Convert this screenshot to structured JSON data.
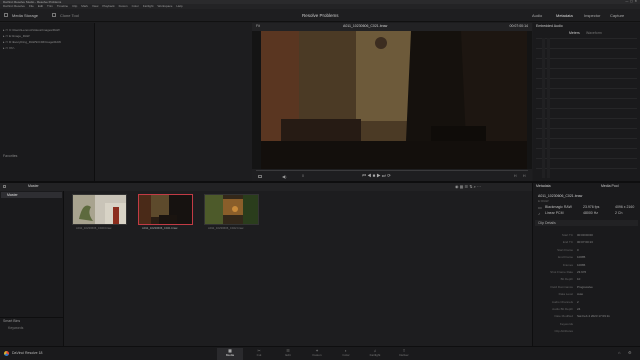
{
  "window": {
    "app_title": "DaVinci Resolve Studio - Resolve Problems",
    "menu": [
      "DaVinci Resolve",
      "File",
      "Edit",
      "Trim",
      "Timeline",
      "Clip",
      "Mark",
      "View",
      "Playback",
      "Fusion",
      "Color",
      "Fairlight",
      "Workspace",
      "Help"
    ]
  },
  "toolbar": {
    "media_storage": "Media Storage",
    "clone_tool": "Clone Tool",
    "project_title": "Resolve Problems",
    "audio": "Audio",
    "metadata": "Metadata",
    "inspector": "Inspector",
    "capture": "Capture"
  },
  "media_storage": {
    "items": [
      "C:\\Users\\Lenovo\\Videos\\Images\\RAW",
      "E:\\Image_RAW",
      "D:\\Everything_RAW\\DCIM\\Image\\RAW",
      "Xh:\\"
    ],
    "favorites": "Favorites"
  },
  "viewer": {
    "zoom": "Fit",
    "clip_name": "A011_10230606_C021.braw",
    "timecode": "00:07:00:14",
    "position": "0",
    "frame_left": "H",
    "frame_right": "H"
  },
  "audio_panel": {
    "title": "Embedded Audio",
    "tabs": [
      "Meters",
      "Waveform"
    ]
  },
  "media_pool": {
    "bin_title": "Master",
    "bins": [
      "Master"
    ],
    "smart_bins": "Smart Bins",
    "smart_bin_items": [
      "Keywords"
    ],
    "clips": [
      {
        "name": "A011_10230606_C020.braw",
        "selected": false
      },
      {
        "name": "A011_10230606_C021.braw",
        "selected": true
      },
      {
        "name": "A011_10230606_C022.braw",
        "selected": false
      }
    ]
  },
  "metadata": {
    "title": "Metadata",
    "mode": "Media Pool",
    "clip_name": "A011_10230606_C021.braw",
    "clip_path": "E:\\RAW",
    "codec": "Blackmagic RAW",
    "fps": "23.976 fps",
    "resolution": "4096 x 2160",
    "audio_codec": "Linear PCM",
    "sample_rate": "48000 Hz",
    "channels": "2 Ch",
    "section": "Clip Details",
    "rows": [
      {
        "label": "Start TC",
        "value": "00:00:00:00"
      },
      {
        "label": "End TC",
        "value": "00:07:00:13"
      },
      {
        "label": "Start Frame",
        "value": "0"
      },
      {
        "label": "End Frame",
        "value": "10085"
      },
      {
        "label": "Frames",
        "value": "10086"
      },
      {
        "label": "Shot Frame Rate",
        "value": "23.976"
      },
      {
        "label": "Bit Depth",
        "value": "10"
      },
      {
        "label": "Field Dominance",
        "value": "Progressive"
      },
      {
        "label": "Data Level",
        "value": "Auto"
      },
      {
        "label": "Audio Channels",
        "value": "2"
      },
      {
        "label": "Audio Bit Depth",
        "value": "24"
      },
      {
        "label": "Date Modified",
        "value": "Sat Feb 4 2023 17:09:11"
      },
      {
        "label": "Keywords",
        "value": ""
      },
      {
        "label": "Clip Attributes",
        "value": ""
      }
    ]
  },
  "bottom": {
    "app_name": "DaVinci Resolve 18",
    "pages": [
      "Media",
      "Cut",
      "Edit",
      "Fusion",
      "Color",
      "Fairlight",
      "Deliver"
    ],
    "active_page": "Media"
  }
}
